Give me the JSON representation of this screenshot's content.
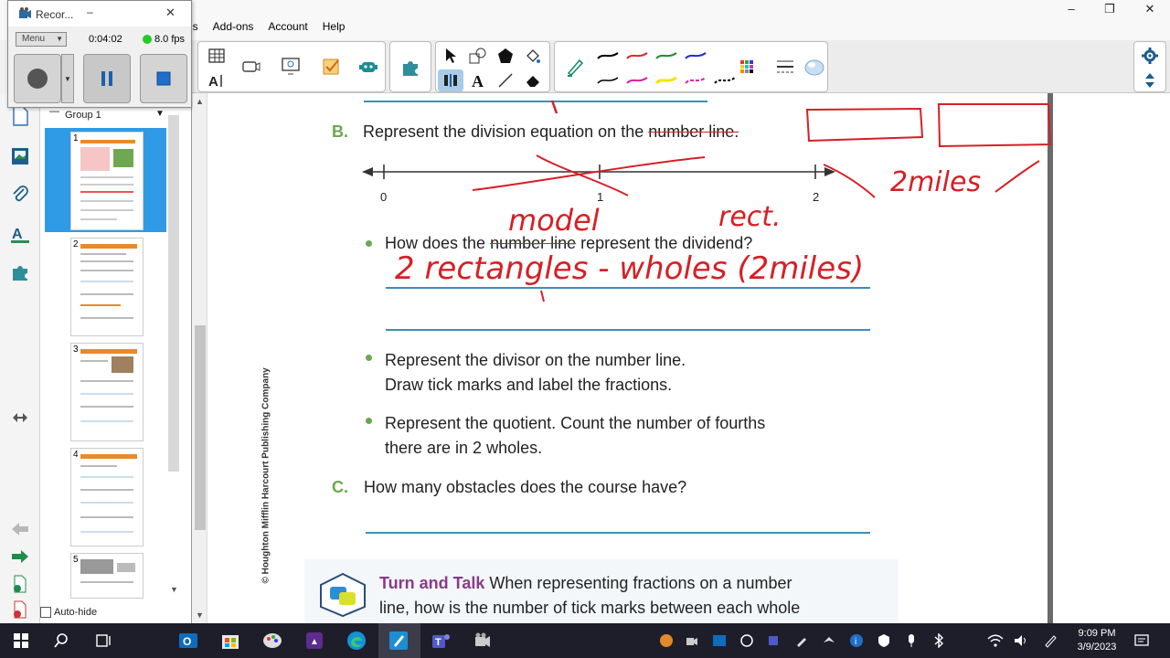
{
  "menu": {
    "items": [
      "Add-ons",
      "Account",
      "Help"
    ],
    "partial_item": "ls"
  },
  "recorder": {
    "title": "Recor...",
    "menu_label": "Menu",
    "elapsed": "0:04:02",
    "fps": "8.0 fps",
    "status_color": "#22cc22"
  },
  "sidebar": {
    "group_label": "Group 1",
    "pages": [
      "1",
      "2",
      "3",
      "4",
      "5"
    ],
    "autohide_label": "Auto-hide"
  },
  "toolbar": {
    "pen_colors": [
      "#000000",
      "#e0262b",
      "#1f8f2a",
      "#1d2fcf",
      "#000000",
      "#e31ca6",
      "#f2e600",
      "#e31ca6",
      "#000000"
    ]
  },
  "document": {
    "section_b": {
      "letter": "B.",
      "question_before": "Represent the division equation on the ",
      "question_struck": "number line.",
      "number_line_labels": [
        "0",
        "1",
        "2"
      ]
    },
    "bullets": [
      {
        "before": "How does the ",
        "struck": "number line",
        "after": " represent the dividend?"
      },
      {
        "line1": "Represent the divisor on the number line.",
        "line2": "Draw tick marks and label the fractions."
      },
      {
        "line1": "Represent the quotient. Count the number of fourths",
        "line2": "there are in 2 wholes."
      }
    ],
    "section_c": {
      "letter": "C.",
      "question": "How many obstacles does the course have?"
    },
    "copyright": "© Houghton Mifflin Harcourt Publishing Company",
    "turn_and_talk": {
      "title": "Turn and Talk",
      "text_line1": "When representing fractions on a number",
      "text_line2": "line, how is the number of tick marks between each whole"
    },
    "handwriting": {
      "model": "model",
      "rect": "rect.",
      "two_miles": "2miles",
      "answer": "2 rectangles - wholes (2miles)"
    }
  },
  "taskbar": {
    "time": "9:09 PM",
    "date": "3/9/2023"
  }
}
